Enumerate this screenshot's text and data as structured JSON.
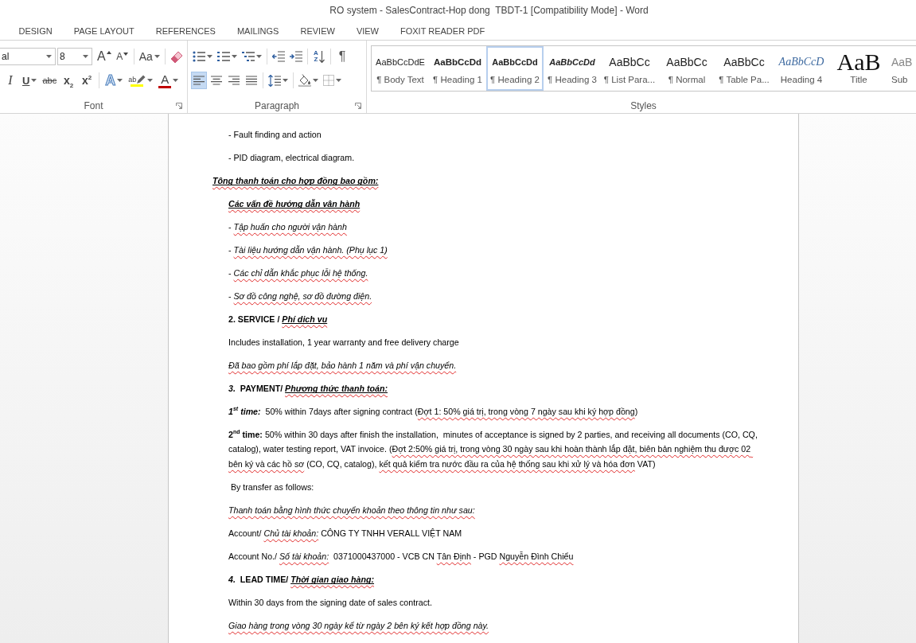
{
  "window": {
    "title": "RO system - SalesContract-Hop dong  TBDT-1 [Compatibility Mode] - Word"
  },
  "tabs": [
    {
      "label": "DESIGN",
      "selected": false
    },
    {
      "label": "PAGE LAYOUT",
      "selected": false
    },
    {
      "label": "REFERENCES",
      "selected": false
    },
    {
      "label": "MAILINGS",
      "selected": false
    },
    {
      "label": "REVIEW",
      "selected": false
    },
    {
      "label": "VIEW",
      "selected": false
    },
    {
      "label": "FOXIT READER PDF",
      "selected": false
    }
  ],
  "tool_groups": [
    {
      "label": "Font",
      "launcher": true,
      "font_name": "al",
      "font_size": "8",
      "lines": [
        {
          "sets": [
            {
              "tools": [
                {
                  "kind": "grow",
                  "label": "A",
                  "selected": false,
                  "dropdown": false
                },
                {
                  "kind": "shrink",
                  "label": "A",
                  "selected": false,
                  "dropdown": false
                }
              ]
            },
            {
              "tools": [
                {
                  "kind": "case",
                  "label": "Aa",
                  "selected": false,
                  "dropdown": true
                }
              ]
            },
            {
              "tools": [
                {
                  "kind": "clear",
                  "selected": false,
                  "dropdown": false
                }
              ]
            }
          ]
        },
        {
          "sets": [
            {
              "tools": [
                {
                  "kind": "italic",
                  "label": "I",
                  "selected": false,
                  "dropdown": false
                },
                {
                  "kind": "underline",
                  "label": "U",
                  "selected": false,
                  "dropdown": true
                },
                {
                  "kind": "strike",
                  "label": "abc",
                  "selected": false,
                  "dropdown": false
                },
                {
                  "kind": "subscript",
                  "label": "x$_{2}$",
                  "selected": false,
                  "dropdown": false
                },
                {
                  "kind": "superscript",
                  "label": "x$^{2}$",
                  "selected": false,
                  "dropdown": false
                }
              ]
            },
            {
              "tools": [
                {
                  "kind": "effects",
                  "label": "A",
                  "selected": false,
                  "dropdown": true
                },
                {
                  "kind": "highlight",
                  "label": "ab",
                  "color": "#ffff00",
                  "selected": false,
                  "dropdown": true
                },
                {
                  "kind": "fontcolor",
                  "label": "A",
                  "color": "#c00000",
                  "selected": false,
                  "dropdown": true
                }
              ]
            }
          ]
        }
      ]
    },
    {
      "label": "Paragraph",
      "launcher": true,
      "lines": [
        {
          "sets": [
            {
              "tools": [
                {
                  "kind": "bullets",
                  "selected": false,
                  "dropdown": true
                },
                {
                  "kind": "numbering",
                  "selected": false,
                  "dropdown": true
                },
                {
                  "kind": "multilevel",
                  "selected": false,
                  "dropdown": true
                }
              ]
            },
            {
              "tools": [
                {
                  "kind": "outdent",
                  "selected": false,
                  "dropdown": false
                },
                {
                  "kind": "indent",
                  "selected": false,
                  "dropdown": false
                }
              ]
            },
            {
              "tools": [
                {
                  "kind": "sort",
                  "letters": [
                    "A",
                    "Z"
                  ],
                  "selected": false,
                  "dropdown": false
                }
              ]
            },
            {
              "tools": [
                {
                  "kind": "marks",
                  "label": "¶",
                  "selected": false,
                  "dropdown": false
                }
              ]
            }
          ]
        },
        {
          "sets": [
            {
              "tools": [
                {
                  "kind": "left",
                  "selected": true,
                  "dropdown": false
                },
                {
                  "kind": "center",
                  "selected": false,
                  "dropdown": false
                },
                {
                  "kind": "right",
                  "selected": false,
                  "dropdown": false
                },
                {
                  "kind": "justify",
                  "selected": false,
                  "dropdown": false
                }
              ]
            },
            {
              "tools": [
                {
                  "kind": "spacing",
                  "selected": false,
                  "dropdown": true
                }
              ]
            },
            {
              "tools": [
                {
                  "kind": "shading",
                  "selected": false,
                  "dropdown": true
                },
                {
                  "kind": "borders",
                  "selected": false,
                  "dropdown": true
                }
              ]
            }
          ]
        }
      ]
    }
  ],
  "styles": {
    "label": "Styles",
    "launcher": false,
    "items": [
      {
        "kind": "body",
        "preview": "AaBbCcDdE",
        "label": "¶ Body Text",
        "selected": false
      },
      {
        "kind": "heading1",
        "preview": "AaBbCcDd",
        "label": "¶ Heading 1",
        "selected": false
      },
      {
        "kind": "heading2",
        "preview": "AaBbCcDd",
        "label": "¶ Heading 2",
        "selected": true
      },
      {
        "kind": "heading3",
        "preview": "AaBbCcDd",
        "label": "¶ Heading 3",
        "selected": false
      },
      {
        "kind": "normal",
        "preview": "AaBbCc",
        "label": "¶ List Para...",
        "selected": false
      },
      {
        "kind": "normal",
        "preview": "AaBbCc",
        "label": "¶ Normal",
        "selected": false
      },
      {
        "kind": "normal",
        "preview": "AaBbCc",
        "label": "¶ Table Pa...",
        "selected": false
      },
      {
        "kind": "heading4",
        "preview": "AaBbCcD",
        "label": "Heading 4",
        "selected": false
      },
      {
        "kind": "title",
        "preview": "AaB",
        "label": "Title",
        "selected": false
      },
      {
        "kind": "subtitle",
        "preview": "AaB",
        "label": "Sub",
        "selected": false
      }
    ]
  },
  "document": {
    "paragraphs": [
      {
        "kind": "body",
        "runs": [
          {
            "kind": "plain",
            "text": "- Fault finding and action"
          }
        ]
      },
      {
        "kind": "body",
        "runs": [
          {
            "kind": "plain",
            "text": "- PID diagram, electrical diagram."
          }
        ]
      },
      {
        "kind": "outdented",
        "runs": [
          {
            "kind": "heading",
            "text": "Tông thanh toán cho hợp đồng bao gồm:"
          }
        ]
      },
      {
        "kind": "body",
        "runs": [
          {
            "kind": "heading",
            "text": "Các vấn đề hướng dẫn vận hành"
          }
        ]
      },
      {
        "kind": "body",
        "runs": [
          {
            "kind": "plain",
            "text": "- "
          },
          {
            "kind": "italic",
            "text": "Tập huấn cho người vận hành"
          }
        ]
      },
      {
        "kind": "body",
        "runs": [
          {
            "kind": "plain",
            "text": "- "
          },
          {
            "kind": "italic",
            "text": "Tài liệu hướng dẫn vận hành. (Phụ lục 1)"
          }
        ]
      },
      {
        "kind": "body",
        "runs": [
          {
            "kind": "plain",
            "text": "- "
          },
          {
            "kind": "italic",
            "text": "Các chỉ dẫn khắc phục lỗi hệ thống."
          }
        ]
      },
      {
        "kind": "body",
        "runs": [
          {
            "kind": "plain",
            "text": "- "
          },
          {
            "kind": "italic",
            "text": "Sơ đồ công nghệ, sơ đồ đường điện."
          }
        ]
      },
      {
        "kind": "body",
        "runs": [
          {
            "kind": "bold",
            "text": "2. SERVICE / "
          },
          {
            "kind": "heading",
            "text": "Phí dịch vụ"
          }
        ]
      },
      {
        "kind": "body",
        "runs": [
          {
            "kind": "plain",
            "text": "Includes installation, 1 year warranty and free delivery charge"
          }
        ]
      },
      {
        "kind": "body",
        "runs": [
          {
            "kind": "italic",
            "text": "Đã bao gồm phí lắp đặt, bảo hành 1 năm và phí vận chuyển."
          }
        ]
      },
      {
        "kind": "body",
        "runs": [
          {
            "kind": "bolditalic",
            "text": "3."
          },
          {
            "kind": "bold",
            "text": "  PAYMENT/ "
          },
          {
            "kind": "heading",
            "text": "Phương thức thanh toán:"
          }
        ]
      },
      {
        "kind": "body",
        "runs": [
          {
            "kind": "bolditalic",
            "text": "1$^{st}$ time:"
          },
          {
            "kind": "plain",
            "text": "  50% within 7days after signing contract ("
          },
          {
            "kind": "flagged",
            "text": "Đợt 1: 50% giá trị, trong vòng 7 ngày sau khi ký hợp đồng"
          },
          {
            "kind": "plain",
            "text": ")"
          }
        ]
      },
      {
        "kind": "body",
        "runs": [
          {
            "kind": "bold",
            "text": "2$^{nd}$ time:"
          },
          {
            "kind": "plain",
            "text": " 50% within 30 days after finish the installation,  minutes of acceptance is signed by 2 parties, and receiving all documents (CO, CQ, catalog), water testing report, VAT invoice. ("
          },
          {
            "kind": "flagged",
            "text": "Đợt 2:50% giá trị, trong vòng 30 ngày sau khi hoàn thành lắp đặt, biên bản nghiệm thu được 02 bên ký và các hồ sơ"
          },
          {
            "kind": "plain",
            "text": " (CO, CQ, catalog), "
          },
          {
            "kind": "flagged",
            "text": "kết quả kiểm tra nước đầu ra của hệ thống sau khi xử lý và hóa đơn"
          },
          {
            "kind": "plain",
            "text": " VAT)"
          }
        ]
      },
      {
        "kind": "body",
        "runs": [
          {
            "kind": "plain",
            "text": " By transfer as follows:"
          }
        ]
      },
      {
        "kind": "body",
        "runs": [
          {
            "kind": "italic",
            "text": "Thanh toán bằng hình thức chuyển khoản theo thông tin như sau:"
          }
        ]
      },
      {
        "kind": "body",
        "runs": [
          {
            "kind": "plain",
            "text": "Account/ "
          },
          {
            "kind": "italic",
            "text": "Chủ tài khoản:"
          },
          {
            "kind": "plain",
            "text": " CÔNG TY TNHH VERALL VIỆT NAM"
          }
        ]
      },
      {
        "kind": "body",
        "runs": [
          {
            "kind": "plain",
            "text": "Account No./ "
          },
          {
            "kind": "italic",
            "text": "Số tài khoản:"
          },
          {
            "kind": "plain",
            "text": "  0371000437000 - VCB CN "
          },
          {
            "kind": "flagged",
            "text": "Tân Định"
          },
          {
            "kind": "plain",
            "text": " - PGD "
          },
          {
            "kind": "flagged",
            "text": "Nguyễn Đình Chiểu"
          }
        ]
      },
      {
        "kind": "body",
        "runs": [
          {
            "kind": "bolditalic",
            "text": "4."
          },
          {
            "kind": "bold",
            "text": "  LEAD TIME/ "
          },
          {
            "kind": "heading",
            "text": "Thời gian giao hàng:"
          }
        ]
      },
      {
        "kind": "body",
        "runs": [
          {
            "kind": "plain",
            "text": "Within 30 days from the signing date of sales contract."
          }
        ]
      },
      {
        "kind": "body",
        "runs": [
          {
            "kind": "italic",
            "text": "Giao hàng trong vòng 30 ngày kể từ ngày 2 bên ký kết hợp đồng này."
          }
        ]
      }
    ]
  }
}
